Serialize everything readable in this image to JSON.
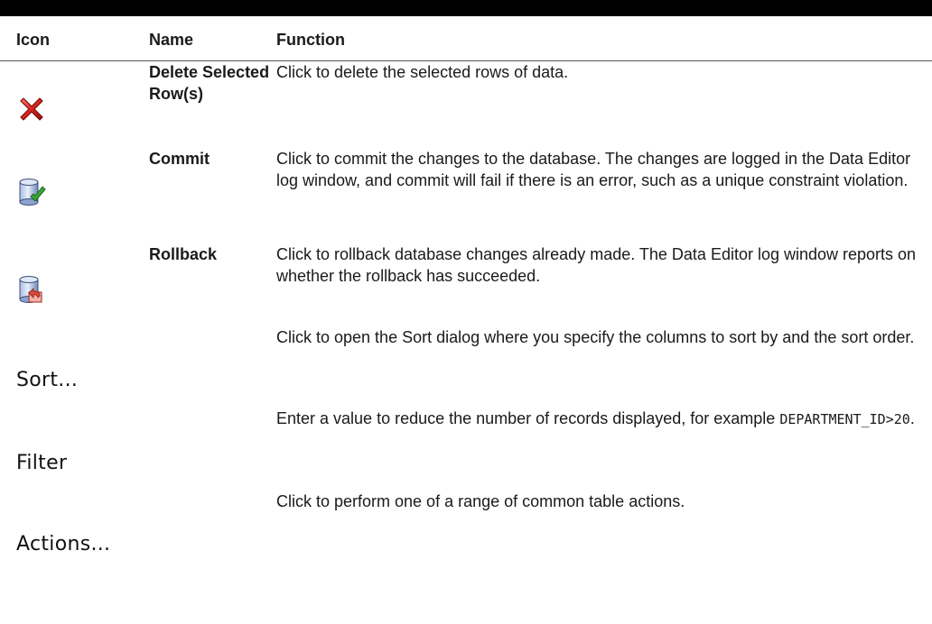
{
  "table": {
    "headers": {
      "icon": "Icon",
      "name": "Name",
      "function": "Function"
    },
    "rows": [
      {
        "icon": "delete-red-x-icon",
        "name": "Delete Selected Row(s)",
        "function": "Click to delete the selected rows of data."
      },
      {
        "icon": "database-commit-checkmark-icon",
        "name": "Commit",
        "function": "Click to commit the changes to the database. The changes are logged in the Data Editor log window, and commit will fail if there is an error, such as a unique constraint violation."
      },
      {
        "icon": "database-rollback-arrow-icon",
        "name": "Rollback",
        "function": "Click to rollback database changes already made. The Data Editor log window reports on whether the rollback has succeeded."
      },
      {
        "button_text": "Sort...",
        "name": "",
        "function": "Click to open the Sort dialog where you specify the columns to sort by and the sort order."
      },
      {
        "button_text": "Filter",
        "name": "",
        "function_prefix": "Enter a value to reduce the number of records displayed, for example ",
        "function_code": "DEPARTMENT_ID>20",
        "function_suffix": "."
      },
      {
        "button_text": "Actions...",
        "name": "",
        "function": "Click to perform one of a range of common table actions."
      }
    ]
  },
  "colors": {
    "top_rule": "#000000",
    "delete_x_red": "#d9251d",
    "db_blue": "#6d87b8",
    "commit_green": "#3aa33a",
    "rollback_red": "#d84b3c"
  }
}
